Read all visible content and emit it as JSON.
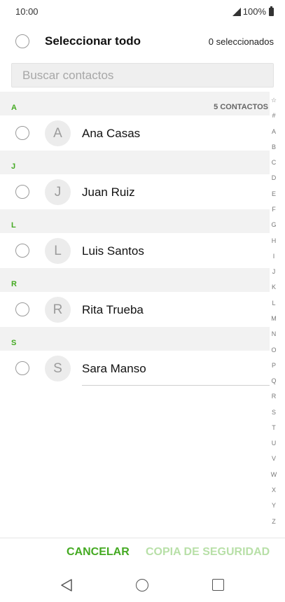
{
  "status_bar": {
    "time": "10:00",
    "battery": "100%",
    "icons": [
      "signal-icon",
      "battery-icon"
    ]
  },
  "select_all": {
    "label": "Seleccionar todo",
    "selected_count": "0 seleccionados"
  },
  "search": {
    "placeholder": "Buscar contactos",
    "value": ""
  },
  "contacts_total": "5 CONTACTOS",
  "sections": [
    {
      "letter": "A",
      "contacts": [
        {
          "initial": "A",
          "name": "Ana Casas"
        }
      ]
    },
    {
      "letter": "J",
      "contacts": [
        {
          "initial": "J",
          "name": "Juan Ruiz"
        }
      ]
    },
    {
      "letter": "L",
      "contacts": [
        {
          "initial": "L",
          "name": "Luis Santos"
        }
      ]
    },
    {
      "letter": "R",
      "contacts": [
        {
          "initial": "R",
          "name": "Rita Trueba"
        }
      ]
    },
    {
      "letter": "S",
      "contacts": [
        {
          "initial": "S",
          "name": "Sara Manso"
        }
      ]
    }
  ],
  "index_letters": [
    "☆",
    "#",
    "A",
    "B",
    "C",
    "D",
    "E",
    "F",
    "G",
    "H",
    "I",
    "J",
    "K",
    "L",
    "M",
    "N",
    "O",
    "P",
    "Q",
    "R",
    "S",
    "T",
    "U",
    "V",
    "W",
    "X",
    "Y",
    "Z"
  ],
  "actions": {
    "cancel": "CANCELAR",
    "backup": "COPIA DE SEGURIDAD"
  },
  "colors": {
    "accent": "#44aa22",
    "accent_disabled": "#b8e0a8",
    "section_background": "#f2f2f2"
  },
  "nav_bar": {
    "icons": [
      "back-icon",
      "home-icon",
      "recents-icon"
    ]
  }
}
